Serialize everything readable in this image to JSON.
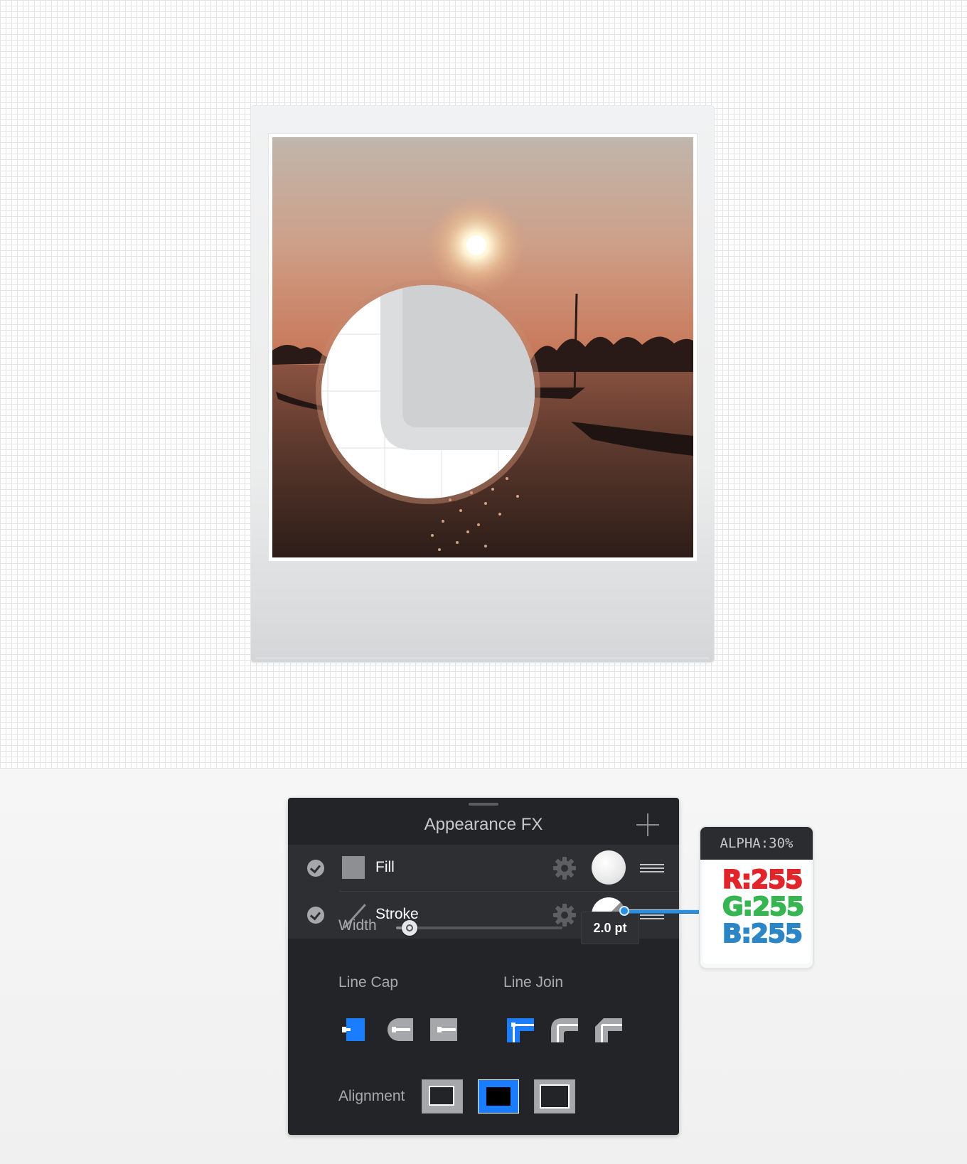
{
  "panel": {
    "title": "Appearance FX",
    "rows": [
      {
        "label": "Fill",
        "enabled": true,
        "icon": "fill-square-icon"
      },
      {
        "label": "Stroke",
        "enabled": true,
        "icon": "stroke-line-icon"
      }
    ],
    "stroke_options": {
      "width_label": "Width",
      "width_value": "2.0 pt",
      "width_slider_fraction": 0.08,
      "line_cap_label": "Line Cap",
      "line_join_label": "Line Join",
      "alignment_label": "Alignment",
      "line_cap_selected": "butt",
      "line_join_selected": "miter",
      "alignment_selected": "center"
    }
  },
  "tooltip": {
    "alpha": "ALPHA:30%",
    "r": "R:255",
    "g": "G:255",
    "b": "B:255"
  },
  "colors": {
    "accent": "#1a7cff",
    "panel_bg": "#232428",
    "row_bg": "#2e2f33",
    "red": "#e1262b",
    "green": "#37b552",
    "blue": "#2d86c4"
  }
}
